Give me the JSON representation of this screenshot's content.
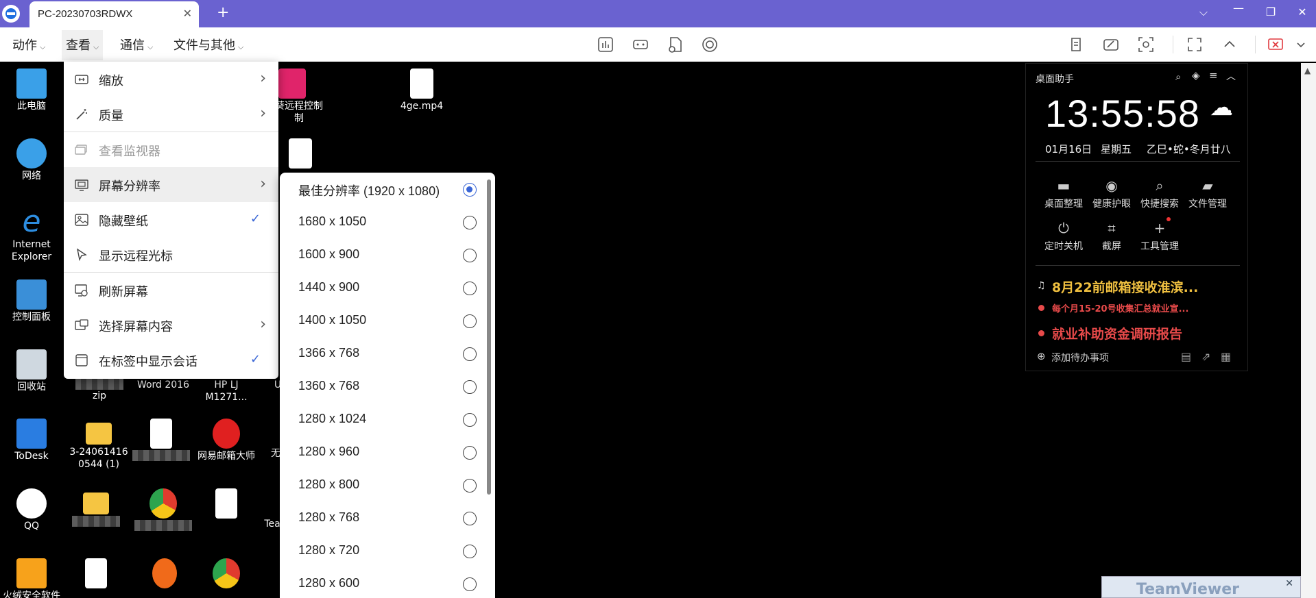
{
  "tab": {
    "title": "PC-20230703RDWX"
  },
  "menubar": {
    "items": [
      "动作",
      "查看",
      "通信",
      "文件与其他"
    ]
  },
  "view_menu": {
    "items": [
      {
        "label": "缩放",
        "submenu": true
      },
      {
        "label": "质量",
        "submenu": true
      },
      {
        "label": "查看监视器",
        "disabled": true
      },
      {
        "label": "屏幕分辨率",
        "submenu": true,
        "hover": true
      },
      {
        "label": "隐藏壁纸",
        "checked": true
      },
      {
        "label": "显示远程光标"
      },
      {
        "label": "刷新屏幕"
      },
      {
        "label": "选择屏幕内容",
        "submenu": true
      },
      {
        "label": "在标签中显示会话",
        "checked": true
      }
    ]
  },
  "resolution_menu": {
    "selected": "最佳分辨率 (1920 x 1080)",
    "items": [
      "最佳分辨率 (1920 x 1080)",
      "1680 x 1050",
      "1600 x 900",
      "1440 x 900",
      "1400 x 1050",
      "1366 x 768",
      "1360 x 768",
      "1280 x 1024",
      "1280 x 960",
      "1280 x 800",
      "1280 x 768",
      "1280 x 720",
      "1280 x 600"
    ]
  },
  "desktop": {
    "icons": [
      {
        "label": "此电脑",
        "color": "#3aa0e8"
      },
      {
        "label": "网络",
        "color": "#3aa0e8"
      },
      {
        "label": "Internet Explorer",
        "color": "#2d8de0"
      },
      {
        "label": "控制面板",
        "color": "#3a8fd8"
      },
      {
        "label": "回收站",
        "color": "#cfd8e0"
      },
      {
        "label": "ToDesk",
        "color": "#2a7de1"
      },
      {
        "label": "QQ",
        "color": "#ffffff"
      },
      {
        "label": "火绒安全软件",
        "color": "#f7a21b"
      }
    ],
    "col2": {
      "remote": "葵远程控制",
      "remote2": "制",
      "mp4": "4ge.mp4",
      "word": "Word 2016",
      "hp1": "HP LJ",
      "hp2": "M1271...",
      "zip": "zip",
      "folder1a": "3-24061416",
      "folder1b": "0544 (1)",
      "mail": "网易邮箱大师",
      "u": "U",
      "wu": "无",
      "tea": "Tea"
    }
  },
  "widget": {
    "title": "桌面助手",
    "time": "13:55:58",
    "date": "01月16日",
    "weekday": "星期五",
    "lunar": "乙巳•蛇•冬月廿八",
    "tools": [
      "桌面整理",
      "健康护眼",
      "快捷搜索",
      "文件管理",
      "定时关机",
      "截屏",
      "工具管理"
    ],
    "todos": [
      {
        "text": "8月22前邮箱接收淮滨...",
        "color": "#f0c040"
      },
      {
        "text": "每个月15-20号收集汇总就业宣...",
        "color": "#e84a4a"
      },
      {
        "text": "就业补助资金调研报告",
        "color": "#e84a4a"
      }
    ],
    "add_todo": "添加待办事项"
  },
  "banner": {
    "text": "TeamViewer"
  }
}
